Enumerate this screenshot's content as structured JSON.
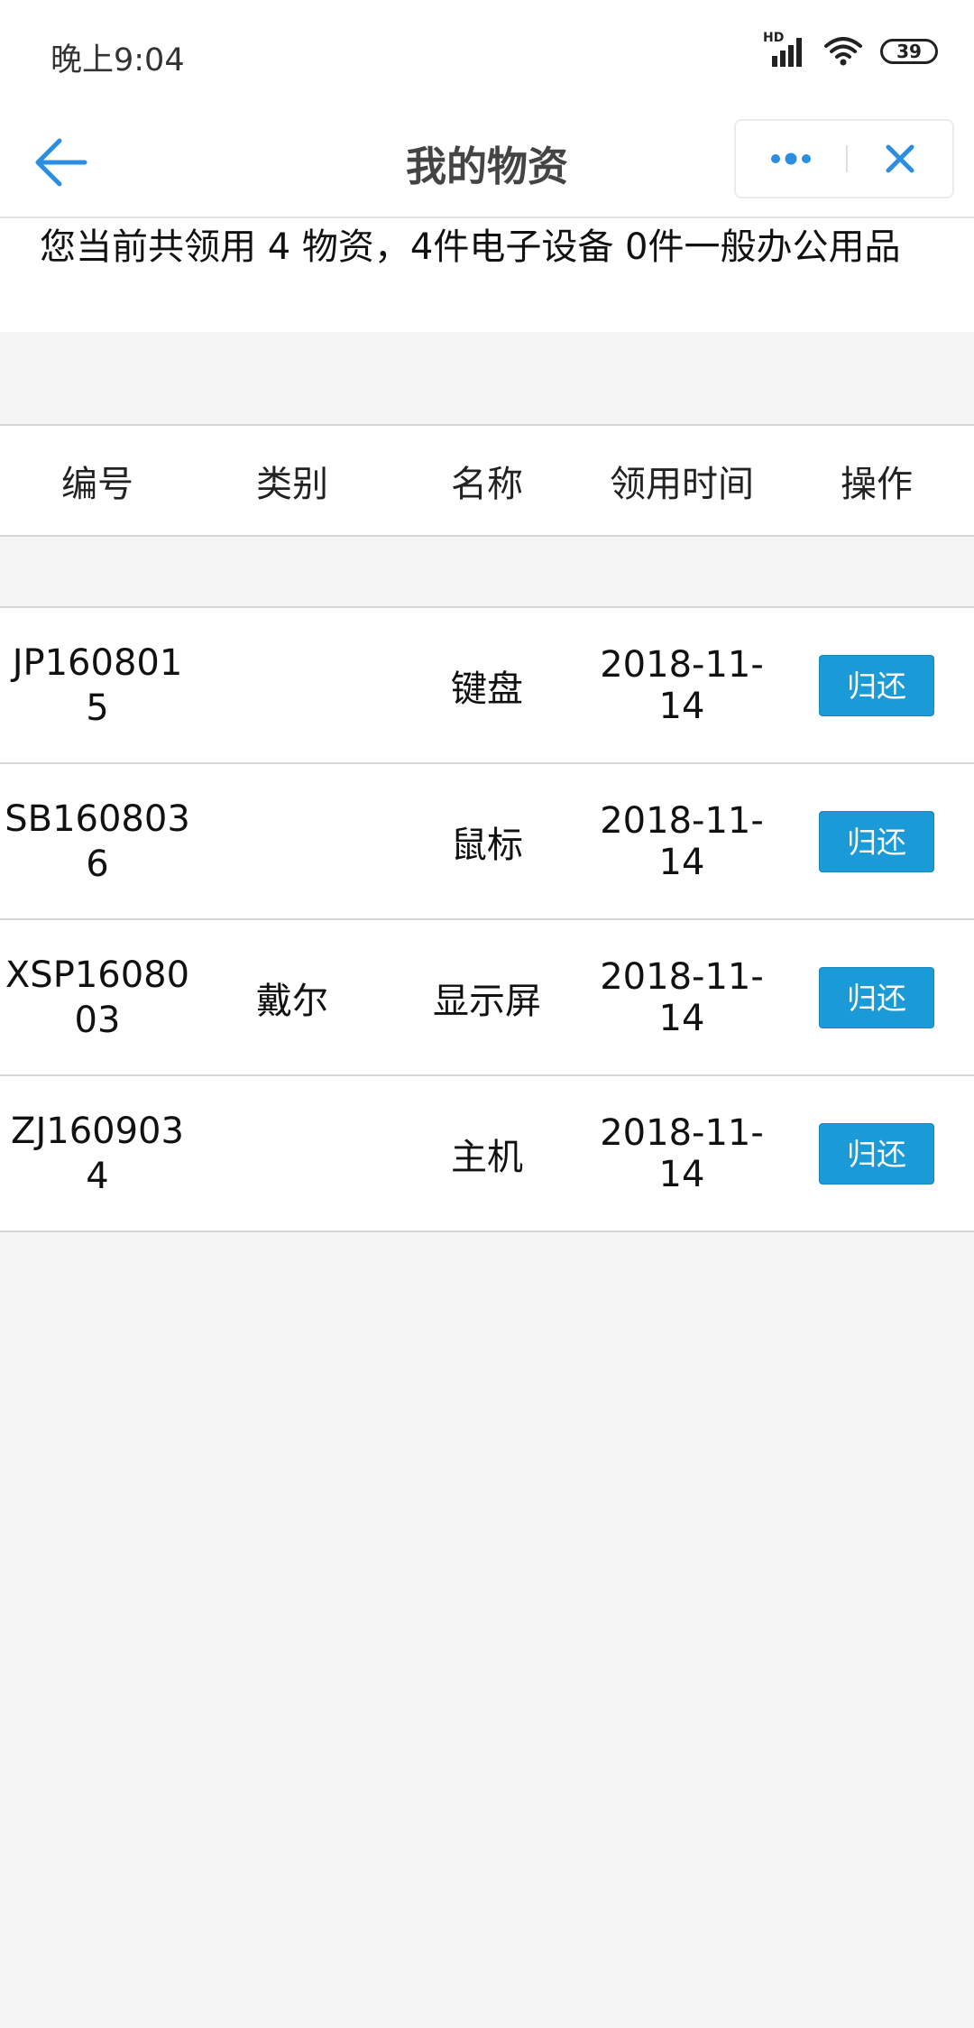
{
  "status_bar": {
    "time": "晚上9:04",
    "signal_label": "HD",
    "battery": "39"
  },
  "nav": {
    "title": "我的物资"
  },
  "summary": {
    "text": "您当前共领用 4 物资，4件电子设备 0件一般办公用品"
  },
  "table": {
    "headers": [
      "编号",
      "类别",
      "名称",
      "领用时间",
      "操作"
    ],
    "rows": [
      {
        "code": "JP1608015",
        "category": "",
        "name": "键盘",
        "date": "2018-11-14",
        "action": "归还"
      },
      {
        "code": "SB1608036",
        "category": "",
        "name": "鼠标",
        "date": "2018-11-14",
        "action": "归还"
      },
      {
        "code": "XSP1608003",
        "category": "戴尔",
        "name": "显示屏",
        "date": "2018-11-14",
        "action": "归还"
      },
      {
        "code": "ZJ1609034",
        "category": "",
        "name": "主机",
        "date": "2018-11-14",
        "action": "归还"
      }
    ]
  },
  "colors": {
    "accent": "#1a9ad6",
    "nav_icon": "#2b8ee0",
    "background": "#f5f5f5"
  },
  "icons": {
    "back": "arrow-left-icon",
    "more": "more-dots-icon",
    "close": "close-icon",
    "wifi": "wifi-icon",
    "signal": "signal-icon",
    "battery": "battery-icon"
  }
}
